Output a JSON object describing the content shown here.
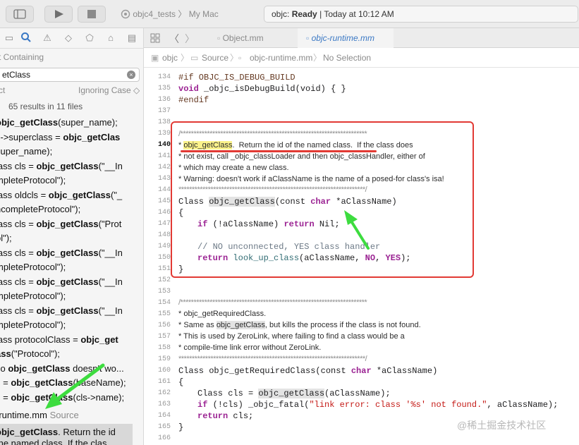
{
  "toolbar": {
    "scheme": "objc4_tests",
    "destination": "My Mac",
    "status_project": "objc:",
    "status_state": "Ready",
    "status_time": "| Today at 10:12 AM"
  },
  "navigator": {
    "containing": "t  Containing",
    "query": "etClass",
    "match_prefix": "ct",
    "match_mode": "Ignoring Case ◇",
    "results_count": "65 results in 11 files",
    "results": [
      {
        "pre": "",
        "b": "objc_getClass",
        "post": "(super_name);"
      },
      {
        "pre": "s->superclass = ",
        "b": "objc_getClas",
        "post": ""
      },
      {
        "pre": "super_name);",
        "b": "",
        "post": ""
      },
      {
        "pre": "lass cls = ",
        "b": "objc_getClass",
        "post": "(\"__In"
      },
      {
        "pre": "mpleteProtocol\");",
        "b": "",
        "post": ""
      },
      {
        "pre": "lass oldcls = ",
        "b": "objc_getClass",
        "post": "(\"_"
      },
      {
        "pre": "ncompleteProtocol\");",
        "b": "",
        "post": ""
      },
      {
        "pre": "lass cls = ",
        "b": "objc_getClass",
        "post": "(\"Prot"
      },
      {
        "pre": "ol\");",
        "b": "",
        "post": ""
      },
      {
        "pre": "lass cls = ",
        "b": "objc_getClass",
        "post": "(\"__In"
      },
      {
        "pre": "mpleteProtocol\");",
        "b": "",
        "post": ""
      },
      {
        "pre": "lass cls = ",
        "b": "objc_getClass",
        "post": "(\"__In"
      },
      {
        "pre": "mpleteProtocol\");",
        "b": "",
        "post": ""
      },
      {
        "pre": "lass cls = ",
        "b": "objc_getClass",
        "post": "(\"__In"
      },
      {
        "pre": "mpleteProtocol\");",
        "b": "",
        "post": ""
      },
      {
        "pre": "lass protocolClass = ",
        "b": "objc_get",
        "post": ""
      },
      {
        "pre": "",
        "b": "ass",
        "post": "(\"Protocol\");"
      },
      {
        "pre": "so ",
        "b": "objc_getClass",
        "post": " doesn't wo..."
      },
      {
        "pre": "s = ",
        "b": "objc_getClass",
        "post": "(baseName);"
      },
      {
        "pre": "s = ",
        "b": "objc_getClass",
        "post": "(cls->name);"
      }
    ],
    "file_result": "-runtime.mm",
    "file_result_kind": "Source",
    "selected_line1_b": "objc_getClass",
    "selected_line1_post": ".  Return the id",
    "selected_line2": "the named class.  If the clas"
  },
  "tabs": {
    "tab1": "Object.mm",
    "tab2": "objc-runtime.mm"
  },
  "jumpbar": {
    "project": "objc",
    "folder": "Source",
    "file": "objc-runtime.mm",
    "selection": "No Selection"
  },
  "code": {
    "lines": [
      "134",
      "135",
      "136",
      "137",
      "138",
      "139",
      "140",
      "141",
      "142",
      "143",
      "144",
      "145",
      "146",
      "147",
      "148",
      "149",
      "150",
      "151",
      "152",
      "153",
      "154",
      "155",
      "156",
      "157",
      "158",
      "159",
      "160",
      "161",
      "162",
      "163",
      "164",
      "165",
      "166"
    ],
    "l134": "#if OBJC_IS_DEBUG_BUILD",
    "l135_kw": "void",
    "l135_rest": " _objc_isDebugBuild(void) { }",
    "l136": "#endif",
    "stars_open": "/**********************************************************************",
    "c140_hl": "objc_getClass",
    "c140_rest": ".  Return the id of the named class.  If the class does",
    "c141": "* not exist, call _objc_classLoader and then objc_classHandler, either of",
    "c142": "* which may create a new class.",
    "c143": "* Warning: doesn't work if aClassName is the name of a posed-for class's isa!",
    "stars_close": "**********************************************************************/",
    "l145_a": "Class ",
    "l145_hl": "objc_getClass",
    "l145_b": "(const ",
    "l145_kw": "char",
    "l145_c": " *aClassName)",
    "brace_open": "{",
    "l147_kw": "if",
    "l147_a": " (!aClassName) ",
    "l147_kw2": "return",
    "l147_b": " Nil;",
    "l149": "// NO unconnected, YES class handler",
    "l150_kw": "return",
    "l150_fn": " look_up_class",
    "l150_a": "(aClassName, ",
    "l150_no": "NO",
    "l150_b": ", ",
    "l150_yes": "YES",
    "l150_c": ");",
    "brace_close": "}",
    "c155": "* objc_getRequiredClass.",
    "c156_a": "* Same as ",
    "c156_hl": "objc_getClass",
    "c156_b": ", but kills the process if the class is not found.",
    "c157": "* This is used by ZeroLink, where failing to find a class would be a",
    "c158": "* compile-time link error without ZeroLink.",
    "l160_a": "Class objc_getRequiredClass(const ",
    "l160_kw": "char",
    "l160_b": " *aClassName)",
    "l162_a": "Class cls = ",
    "l162_hl": "objc_getClass",
    "l162_b": "(aClassName);",
    "l163_kw": "if",
    "l163_a": " (!cls) _objc_fatal(",
    "l163_str": "\"link error: class '%s' not found.\"",
    "l163_b": ", aClassName);",
    "l164_kw": "return",
    "l164_a": " cls;"
  },
  "watermark": "@稀土掘金技术社区",
  "colors": {
    "highlight_box": "#e23a34",
    "annotation_arrow": "#3ddc3f",
    "keyword": "#9b2393",
    "match_highlight": "#fbf28b"
  }
}
